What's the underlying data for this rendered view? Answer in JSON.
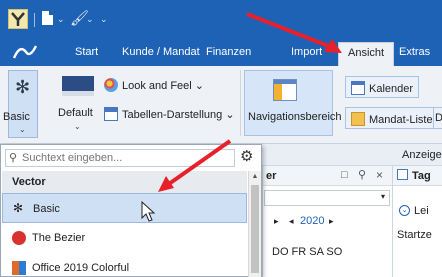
{
  "quick_access": {
    "app_icon": "app-logo-icon",
    "new_document_icon": "document-icon",
    "paint_icon": "paint-brush-icon",
    "caret": "⌄"
  },
  "tabs": [
    {
      "label": "Start"
    },
    {
      "label": "Kunde / Mandat"
    },
    {
      "label": "Finanzen"
    },
    {
      "label": "Import"
    },
    {
      "label": "Ansicht",
      "active": true
    },
    {
      "label": "Extras"
    }
  ],
  "ribbon": {
    "basic_label": "Basic",
    "default_label": "Default",
    "look_and_feel_label": "Look and Feel",
    "tabellen_label": "Tabellen-Darstellung",
    "navigationsbereich_label": "Navigationsbereich",
    "kalender_label": "Kalender",
    "mandat_liste_label": "Mandat-Liste",
    "cut_label": "D"
  },
  "subbar": {
    "anzeige_label": "Anzeige"
  },
  "dropdown": {
    "search_placeholder": "Suchtext eingeben...",
    "group_label": "Vector",
    "themes": [
      {
        "label": "Basic",
        "selected": true
      },
      {
        "label": "The Bezier",
        "selected": false
      },
      {
        "label": "Office 2019 Colorful",
        "selected": false
      }
    ]
  },
  "panel_mid": {
    "title_fragment": "er",
    "pin_icon": "pin-icon",
    "close_icon": "close-icon",
    "year": "2020",
    "weekdays_fragment": "DO FR SA SO"
  },
  "panel_right": {
    "title_fragment": "Tag",
    "item_fragment": "Lei",
    "start_fragment": "Startze"
  },
  "colors": {
    "titlebar": "#1e62b6",
    "ribbon": "#eef2f7",
    "selection": "#cfe0f5",
    "arrow": "#e8202a"
  }
}
